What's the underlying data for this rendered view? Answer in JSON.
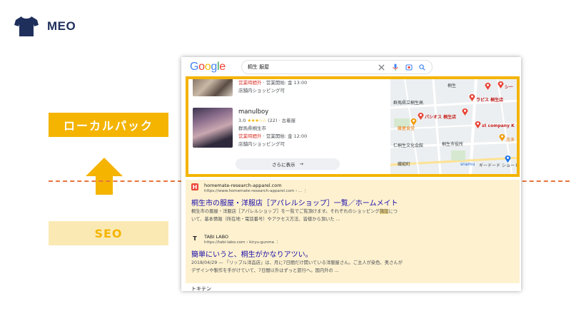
{
  "header": {
    "label": "MEO",
    "icon": "tshirt-icon",
    "icon_color": "#1f2f5c"
  },
  "annotations": {
    "local_pack_label": "ローカルパック",
    "seo_label": "SEO",
    "arrow": "up-arrow-icon",
    "accent_color": "#f4b400",
    "divider_color": "#e8743b"
  },
  "search": {
    "logo_letters": [
      "G",
      "o",
      "o",
      "g",
      "l",
      "e"
    ],
    "query": "桐生 服屋",
    "icons": [
      "close-icon",
      "mic-icon",
      "camera-icon",
      "search-icon"
    ]
  },
  "local_pack": {
    "listings": [
      {
        "name": "",
        "rating": "",
        "meta": "",
        "location": "",
        "status_closed": "営業時間外",
        "status_rest": " · 営業開始: 金 13:00",
        "note": "店舗内ショッピング可"
      },
      {
        "name": "manulboy",
        "rating": "3.0",
        "stars": "★★★☆☆",
        "meta": "(22) · 古着屋",
        "location": "群馬県桐生市",
        "status_closed": "営業時間外",
        "status_rest": " · 営業開始: 金 12:00",
        "note": "店舗内ショッピング可"
      }
    ],
    "more_button": "さらに表示",
    "more_arrow": "→",
    "map_labels": {
      "top_station": "桐生",
      "pref": "群馬県立桐生高",
      "shop_a": "パシオス 桐生店",
      "shop_b": "ラピス 桐生店",
      "shop_c": "st company K",
      "shop_d": "シー",
      "shop_e": "志多",
      "restaurant": "藤屋食堂",
      "culture": "仁桐生文化会館",
      "city_hall": "桐生市役所",
      "town": "織姫町",
      "road": "",
      "station_right": "snamu",
      "bottom_right": "ギードード ショートア"
    }
  },
  "organic": [
    {
      "favicon": "H",
      "favicon_color": "#ea4335",
      "site": "homemate-research-apparel.com",
      "url": "https://www.homemate-research-apparel.com › ...",
      "menu": "⋮",
      "title": "桐生市の服屋・洋服店［アパレルショップ］一覧／ホームメイト",
      "snippet_before": "桐生市の服屋・洋服店［アパレルショップ］を一覧でご覧頂けます。それぞれのショッピング",
      "snippet_highlight1": "施",
      "snippet_highlight2": "設",
      "snippet_after": "について、基本情報（所在地・電話番号）やアクセス方法、皆様から頂いた ..."
    },
    {
      "favicon": "T",
      "favicon_color": "#202124",
      "site": "TABI LABO",
      "url": "https://tabi-labo.com › kiryu-gunma",
      "menu": "⋮",
      "title": "簡単にいうと、桐生がかなりアツい。",
      "snippet_before": "2018/04/29 — 「リップル洋品店」は、月に7日間だけ開いている洋服屋さん。ご主人が染色、奥さんがデザインや製作を手がけていて、7日間以外はずっと旅行へ。国内外の ...",
      "snippet_highlight1": "",
      "snippet_highlight2": "",
      "snippet_after": ""
    }
  ],
  "next_result_partial": "トキテン"
}
